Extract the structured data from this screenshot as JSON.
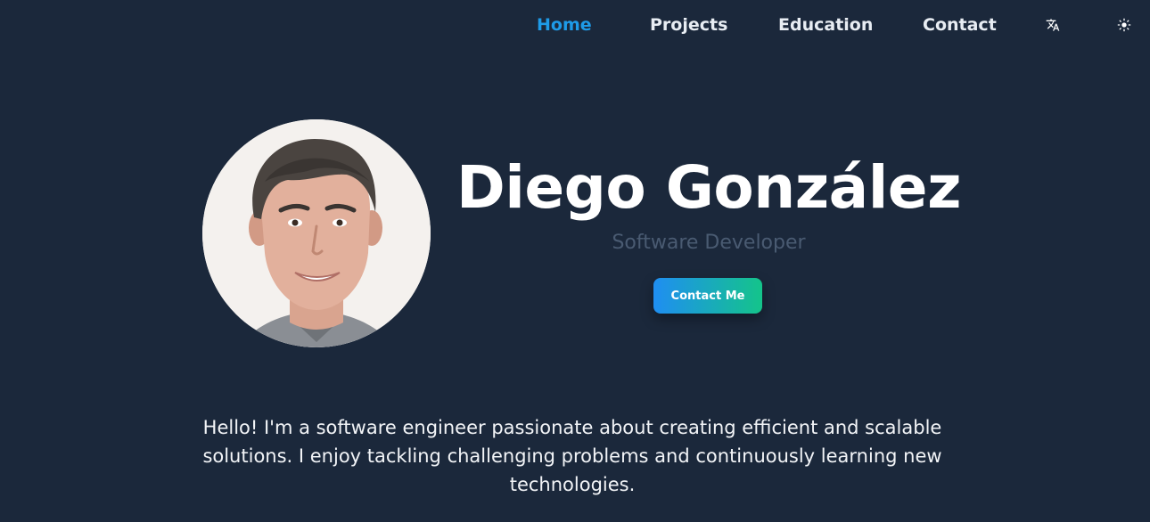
{
  "nav": {
    "items": [
      {
        "label": "Home",
        "active": true
      },
      {
        "label": "Projects",
        "active": false
      },
      {
        "label": "Education",
        "active": false
      },
      {
        "label": "Contact",
        "active": false
      }
    ],
    "icons": {
      "translate": "translate-icon",
      "theme": "sun-icon"
    }
  },
  "hero": {
    "name": "Diego González",
    "role": "Software Developer",
    "cta_label": "Contact Me",
    "avatar": "profile-photo"
  },
  "bio": {
    "text": "Hello! I'm a software engineer passionate about creating efficient and scalable solutions. I enjoy tackling challenging problems and continuously learning new technologies."
  },
  "colors": {
    "background": "#1b283b",
    "accent": "#1e9be8",
    "gradient_start": "#1f8ef2",
    "gradient_end": "#14c48a",
    "muted_text": "#4a5b72"
  }
}
